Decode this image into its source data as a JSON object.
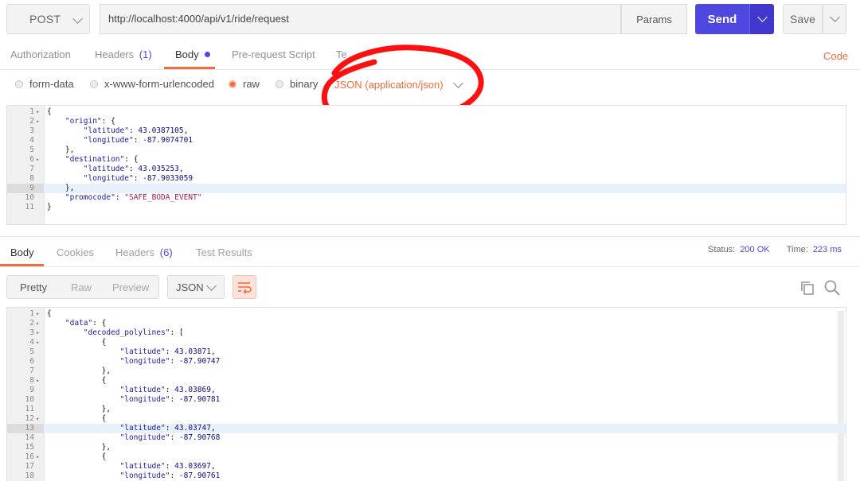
{
  "request": {
    "method": "POST",
    "url": "http://localhost:4000/api/v1/ride/request",
    "params_label": "Params",
    "send_label": "Send",
    "save_label": "Save"
  },
  "req_tabs": {
    "authorization": "Authorization",
    "headers": "Headers",
    "headers_count": "(1)",
    "body": "Body",
    "prerequest": "Pre-request Script",
    "tests_partial": "Te",
    "code": "Code"
  },
  "body_types": {
    "form_data": "form-data",
    "urlencoded": "x-www-form-urlencoded",
    "raw": "raw",
    "binary": "binary",
    "content_type": "JSON (application/json)"
  },
  "request_body": [
    {
      "n": "1",
      "fold": true,
      "text": "{"
    },
    {
      "n": "2",
      "fold": true,
      "text": "    \"origin\": {"
    },
    {
      "n": "3",
      "fold": false,
      "text": "        \"latitude\": 43.0387105,"
    },
    {
      "n": "4",
      "fold": false,
      "text": "        \"longitude\": -87.9074701"
    },
    {
      "n": "5",
      "fold": false,
      "text": "    },"
    },
    {
      "n": "6",
      "fold": true,
      "text": "    \"destination\": {"
    },
    {
      "n": "7",
      "fold": false,
      "text": "        \"latitude\": 43.035253,"
    },
    {
      "n": "8",
      "fold": false,
      "text": "        \"longitude\": -87.9033059"
    },
    {
      "n": "9",
      "fold": false,
      "text": "    },"
    },
    {
      "n": "10",
      "fold": false,
      "text": "    \"promocode\": \"SAFE_BODA_EVENT\""
    },
    {
      "n": "11",
      "fold": false,
      "text": "}"
    }
  ],
  "resp_tabs": {
    "body": "Body",
    "cookies": "Cookies",
    "headers": "Headers",
    "headers_count": "(6)",
    "test_results": "Test Results"
  },
  "status": {
    "status_label": "Status:",
    "status_value": "200 OK",
    "time_label": "Time:",
    "time_value": "223 ms"
  },
  "resp_toolbar": {
    "pretty": "Pretty",
    "raw": "Raw",
    "preview": "Preview",
    "format": "JSON"
  },
  "response_body": [
    {
      "n": "1",
      "fold": true,
      "text": "{"
    },
    {
      "n": "2",
      "fold": true,
      "text": "    \"data\": {"
    },
    {
      "n": "3",
      "fold": true,
      "text": "        \"decoded_polylines\": ["
    },
    {
      "n": "4",
      "fold": true,
      "text": "            {"
    },
    {
      "n": "5",
      "fold": false,
      "text": "                \"latitude\": 43.03871,"
    },
    {
      "n": "6",
      "fold": false,
      "text": "                \"longitude\": -87.90747"
    },
    {
      "n": "7",
      "fold": false,
      "text": "            },"
    },
    {
      "n": "8",
      "fold": true,
      "text": "            {"
    },
    {
      "n": "9",
      "fold": false,
      "text": "                \"latitude\": 43.03869,"
    },
    {
      "n": "10",
      "fold": false,
      "text": "                \"longitude\": -87.90781"
    },
    {
      "n": "11",
      "fold": false,
      "text": "            },"
    },
    {
      "n": "12",
      "fold": true,
      "text": "            {"
    },
    {
      "n": "13",
      "fold": false,
      "text": "                \"latitude\": 43.03747,"
    },
    {
      "n": "14",
      "fold": false,
      "text": "                \"longitude\": -87.90768"
    },
    {
      "n": "15",
      "fold": false,
      "text": "            },"
    },
    {
      "n": "16",
      "fold": true,
      "text": "            {"
    },
    {
      "n": "17",
      "fold": false,
      "text": "                \"latitude\": 43.03697,"
    },
    {
      "n": "18",
      "fold": false,
      "text": "                \"longitude\": -87.90761"
    }
  ],
  "colors": {
    "accent_orange": "#f26b3a",
    "send_blue": "#4e47e0",
    "annotation_red": "#ff1010"
  }
}
